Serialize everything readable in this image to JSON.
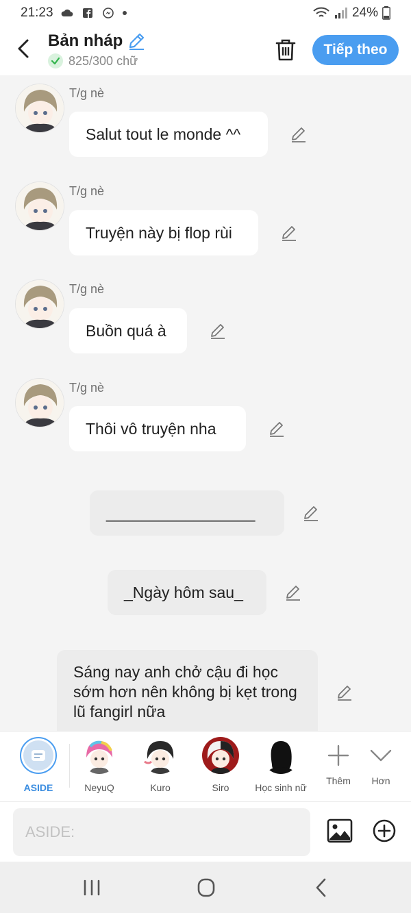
{
  "status_bar": {
    "time": "21:23",
    "battery": "24%",
    "left_icons": [
      "cloud-icon",
      "facebook-icon",
      "messenger-icon",
      "dot-icon"
    ],
    "right_icons": [
      "wifi-icon",
      "signal-icon",
      "battery-icon"
    ]
  },
  "header": {
    "title": "Bản nháp",
    "word_count": "825/300 chữ",
    "next_label": "Tiếp theo",
    "accent": "#4a9df0"
  },
  "messages": [
    {
      "sender": "T/g nè",
      "text": "Salut tout le monde ^^"
    },
    {
      "sender": "T/g nè",
      "text": "Truyện này bị flop rùi"
    },
    {
      "sender": "T/g nè",
      "text": "Buồn quá à"
    },
    {
      "sender": "T/g nè",
      "text": "Thôi vô truyện nha"
    },
    {
      "text": "_________________"
    },
    {
      "text": "_Ngày hôm sau_"
    },
    {
      "text": "Sáng nay anh chở cậu đi học sớm hơn nên không bị kẹt trong lũ fangirl nữa"
    }
  ],
  "characters": [
    {
      "label": "ASIDE"
    },
    {
      "label": "NeyuQ"
    },
    {
      "label": "Kuro"
    },
    {
      "label": "Siro"
    },
    {
      "label": "Học sinh nữ"
    },
    {
      "label": "Thêm"
    },
    {
      "label": "Hơn"
    }
  ],
  "input": {
    "placeholder": "ASIDE:",
    "value": ""
  }
}
